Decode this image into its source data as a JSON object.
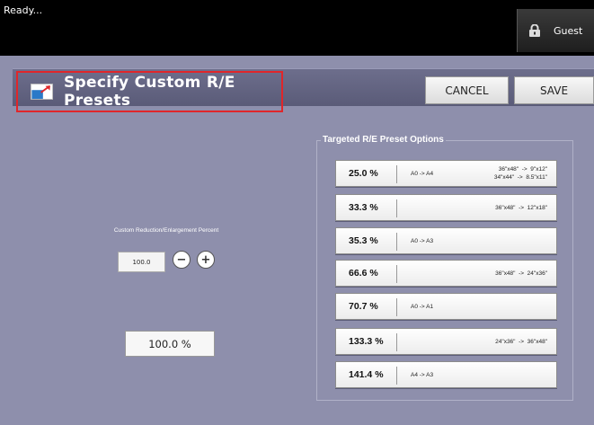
{
  "status": {
    "text": "Ready..."
  },
  "user": {
    "label": "Guest",
    "icon": "lock-icon"
  },
  "header": {
    "title": "Specify Custom R/E Presets",
    "cancel_label": "CANCEL",
    "save_label": "SAVE"
  },
  "custom": {
    "label": "Custom Reduction/Enlargement Percent",
    "value": "100.0",
    "result": "100.0 %"
  },
  "presets": {
    "group_label": "Targeted R/E Preset Options",
    "items": [
      {
        "percent": "25.0 %",
        "iso": "A0 -> A4",
        "arch": [
          "36\"x48\"  ->  9\"x12\"",
          "34\"x44\"  ->  8.5\"x11\""
        ]
      },
      {
        "percent": "33.3 %",
        "iso": "",
        "arch": [
          "36\"x48\"  ->  12\"x18\""
        ]
      },
      {
        "percent": "35.3 %",
        "iso": "A0 -> A3",
        "arch": []
      },
      {
        "percent": "66.6 %",
        "iso": "",
        "arch": [
          "36\"x48\"  ->  24\"x36\""
        ]
      },
      {
        "percent": "70.7 %",
        "iso": "A0 -> A1",
        "arch": []
      },
      {
        "percent": "133.3 %",
        "iso": "",
        "arch": [
          "24\"x36\"  ->  36\"x48\""
        ]
      },
      {
        "percent": "141.4 %",
        "iso": "A4 -> A3",
        "arch": []
      }
    ]
  },
  "colors": {
    "panel": "#8e8fac",
    "header": "#5a5b78",
    "highlight": "#e0262a"
  }
}
